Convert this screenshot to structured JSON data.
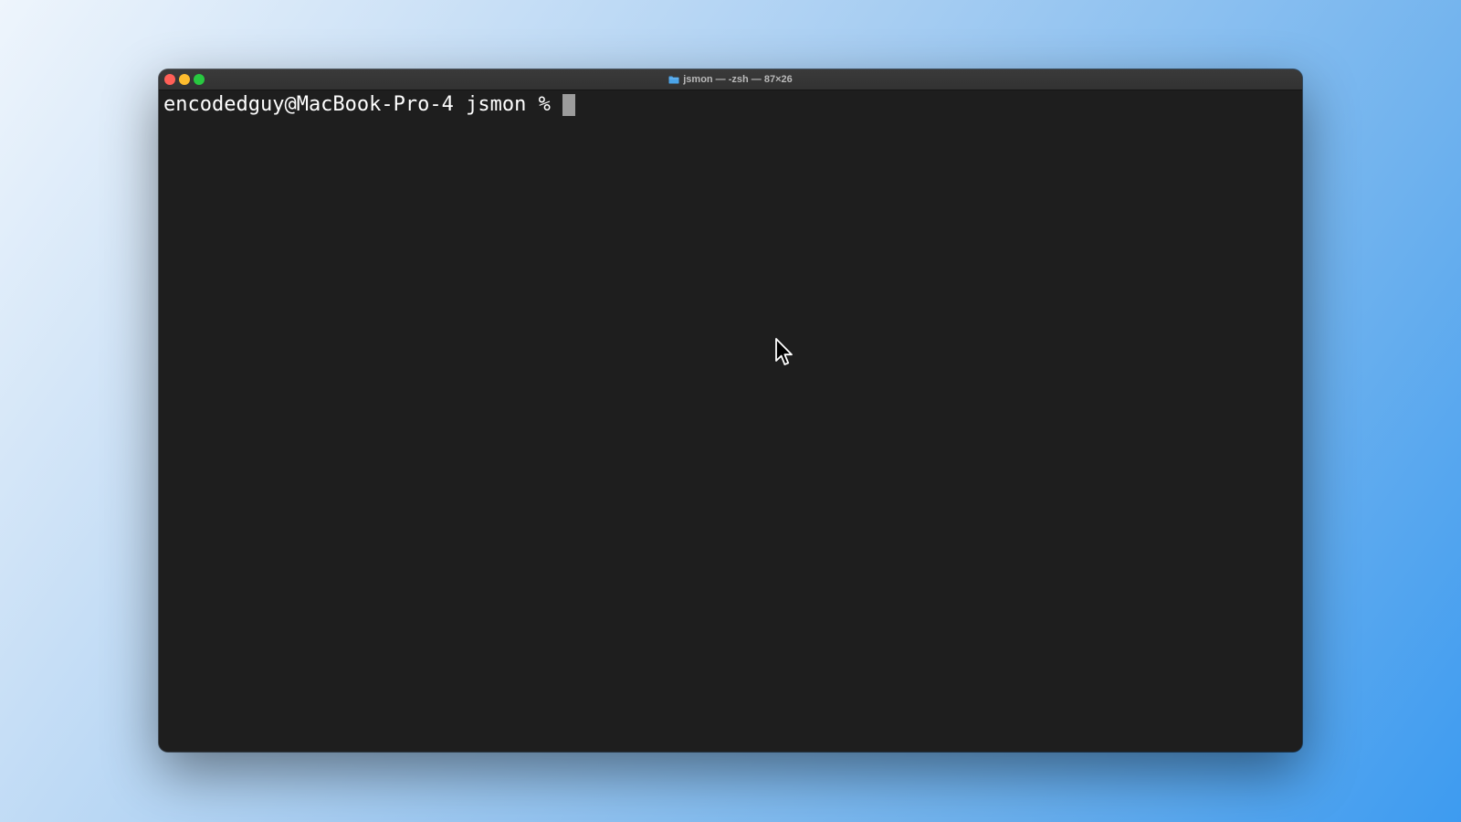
{
  "terminal": {
    "title": "jsmon — -zsh — 87×26",
    "title_icon": "folder-icon",
    "prompt": "encodedguy@MacBook-Pro-4 jsmon % ",
    "input_value": ""
  },
  "colors": {
    "close": "#ff5f57",
    "minimize": "#febc2e",
    "maximize": "#28c840",
    "terminal_background": "#1e1e1e",
    "terminal_text": "#ffffff",
    "cursor": "#9c9c9c",
    "folder_icon": "#4aa3e8"
  },
  "icons": {
    "close_button": "close-icon",
    "minimize_button": "minimize-icon",
    "maximize_button": "maximize-icon",
    "pointer": "mouse-pointer-icon"
  }
}
